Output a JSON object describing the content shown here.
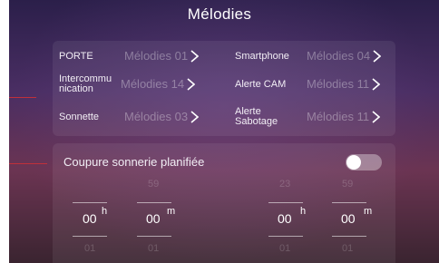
{
  "title": "Mélodies",
  "melodies": [
    {
      "label": "PORTE",
      "value": "Mélodies 01"
    },
    {
      "label": "Smartphone",
      "value": "Mélodies 04"
    },
    {
      "label": "Intercommu\nnication",
      "value": "Mélodies 14"
    },
    {
      "label": "Alerte CAM",
      "value": "Mélodies 11"
    },
    {
      "label": "Sonnette",
      "value": "Mélodies 03"
    },
    {
      "label": "Alerte\nSabotage",
      "value": "Mélodies 11"
    }
  ],
  "schedule": {
    "label": "Coupure sonnerie planifiée",
    "toggle_on": false,
    "start": {
      "hour_prev": "",
      "minute_prev": "59",
      "hour": "00",
      "minute": "00",
      "hour_next": "01",
      "minute_next": "01",
      "hour_unit": "h",
      "minute_unit": "m"
    },
    "end": {
      "hour_prev": "23",
      "minute_prev": "59",
      "hour": "00",
      "minute": "00",
      "hour_next": "01",
      "minute_next": "01",
      "hour_unit": "h",
      "minute_unit": "m"
    }
  },
  "colors": {
    "accent_callout": "#c0303a"
  }
}
